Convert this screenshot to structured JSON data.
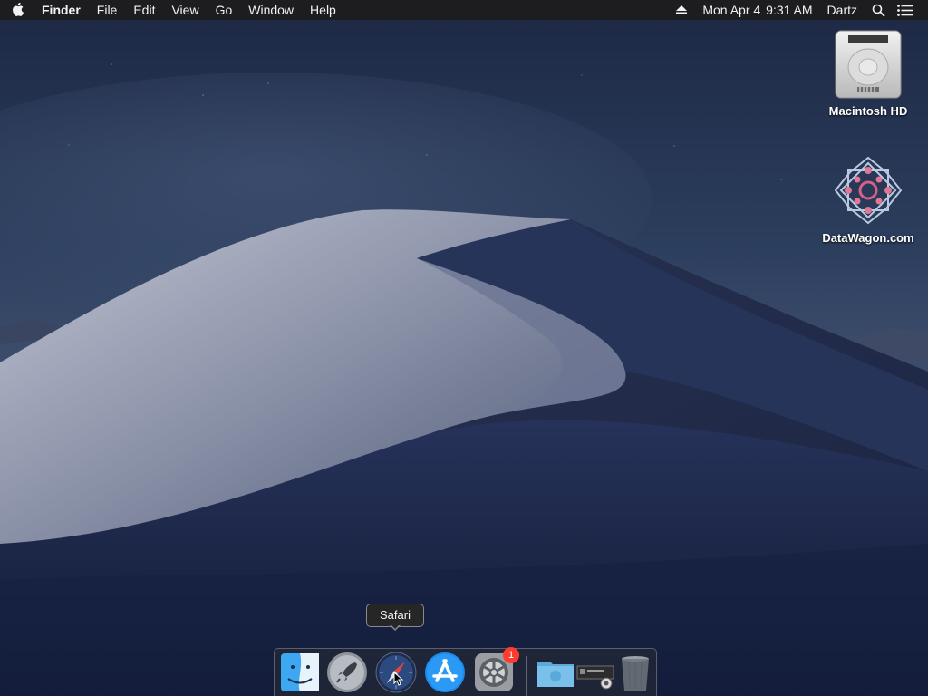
{
  "menubar": {
    "apple_icon": "apple-icon",
    "app_name": "Finder",
    "menus": [
      "File",
      "Edit",
      "View",
      "Go",
      "Window",
      "Help"
    ],
    "date": "Mon Apr 4",
    "time": "9:31 AM",
    "user": "Dartz",
    "icons": [
      "eject-icon",
      "search-icon",
      "notification-center-icon"
    ]
  },
  "desktop": {
    "items": [
      {
        "label": "Macintosh HD",
        "icon": "hard-drive-icon"
      },
      {
        "label": "DataWagon.com",
        "icon": "datawagon-logo-icon"
      }
    ]
  },
  "dock": {
    "apps": [
      {
        "name": "Finder",
        "icon": "finder-icon",
        "running": true
      },
      {
        "name": "Launchpad",
        "icon": "launchpad-icon",
        "running": false
      },
      {
        "name": "Safari",
        "icon": "safari-icon",
        "running": false
      },
      {
        "name": "App Store",
        "icon": "app-store-icon",
        "running": false
      },
      {
        "name": "System Preferences",
        "icon": "system-preferences-icon",
        "running": true,
        "badge": "1"
      }
    ],
    "others": [
      {
        "name": "Downloads",
        "icon": "folder-icon"
      },
      {
        "name": "Screenshot",
        "icon": "screenshot-icon"
      },
      {
        "name": "Trash",
        "icon": "trash-icon"
      }
    ],
    "tooltip": "Safari"
  },
  "colors": {
    "menubar_bg": "#1d1d1f",
    "badge": "#ff3b30",
    "sky_top": "#1e2c48",
    "dune_light": "#a7acbd"
  }
}
